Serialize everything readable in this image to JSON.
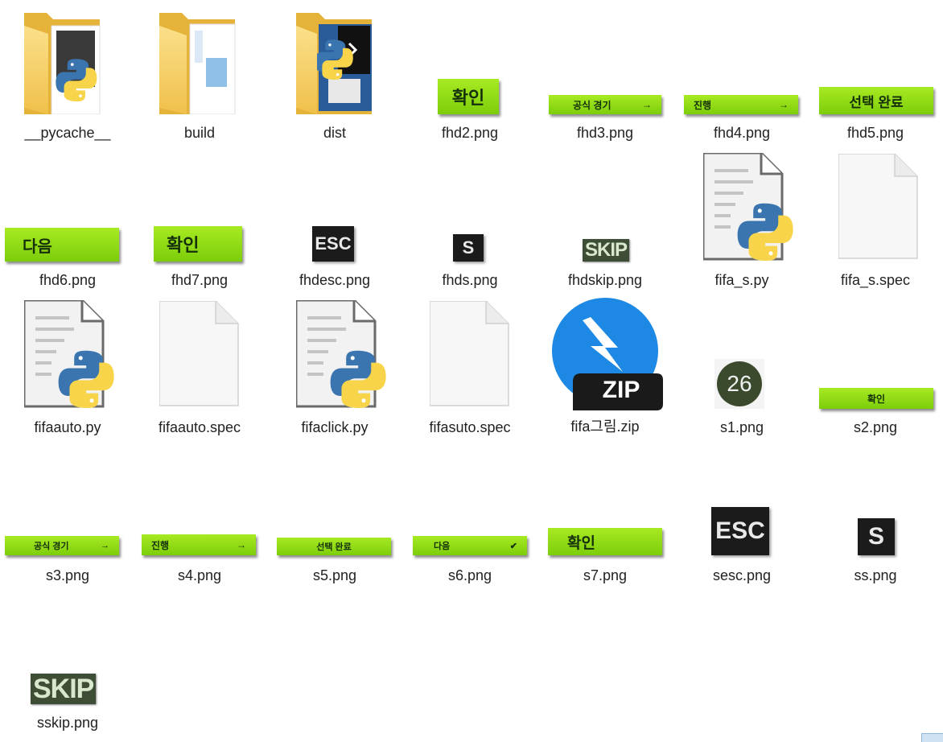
{
  "files": [
    {
      "name": "__pycache__"
    },
    {
      "name": "build"
    },
    {
      "name": "dist"
    },
    {
      "name": "fhd2.png",
      "text": "확인"
    },
    {
      "name": "fhd3.png",
      "text": "공식 경기",
      "arrow": "→"
    },
    {
      "name": "fhd4.png",
      "text": "진행",
      "arrow": "→"
    },
    {
      "name": "fhd5.png",
      "text": "선택 완료"
    },
    {
      "name": "fhd6.png",
      "text": "다음"
    },
    {
      "name": "fhd7.png",
      "text": "확인"
    },
    {
      "name": "fhdesc.png",
      "text": "ESC"
    },
    {
      "name": "fhds.png",
      "text": "S"
    },
    {
      "name": "fhdskip.png",
      "text": "SKIP"
    },
    {
      "name": "fifa_s.py"
    },
    {
      "name": "fifa_s.spec"
    },
    {
      "name": "fifaauto.py"
    },
    {
      "name": "fifaauto.spec"
    },
    {
      "name": "fifaclick.py"
    },
    {
      "name": "fifasuto.spec"
    },
    {
      "name": "fifa그림.zip",
      "text": "ZIP"
    },
    {
      "name": "s1.png",
      "text": "26"
    },
    {
      "name": "s2.png",
      "text": "확인"
    },
    {
      "name": "s3.png",
      "text": "공식 경기",
      "arrow": "→"
    },
    {
      "name": "s4.png",
      "text": "진행",
      "arrow": "→"
    },
    {
      "name": "s5.png",
      "text": "선택 완료"
    },
    {
      "name": "s6.png",
      "text": "다음",
      "arrow": "✔"
    },
    {
      "name": "s7.png",
      "text": "확인"
    },
    {
      "name": "sesc.png",
      "text": "ESC"
    },
    {
      "name": "ss.png",
      "text": "S"
    },
    {
      "name": "sskip.png",
      "text": "SKIP"
    }
  ],
  "colors": {
    "folder": "#f3c94e",
    "python_blue": "#3b75b0",
    "python_yellow": "#f7d44a",
    "button_green": "#8fdc16",
    "zip_blue": "#1e88e5"
  }
}
